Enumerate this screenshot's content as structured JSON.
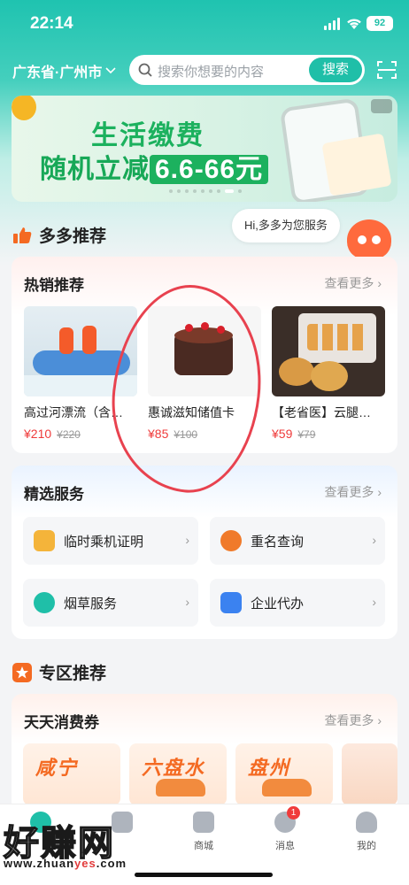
{
  "status": {
    "time": "22:14",
    "battery": "92"
  },
  "header": {
    "city": "广东省·广州市",
    "search_placeholder": "搜索你想要的内容",
    "search_button": "搜索"
  },
  "banner": {
    "line1": "生活缴费",
    "line2_prefix": "随机立减",
    "line2_amount": "6.6-66元"
  },
  "recommend": {
    "title": "多多推荐",
    "bubble": "Hi,多多为您服务"
  },
  "hot": {
    "title": "热销推荐",
    "more": "查看更多",
    "items": [
      {
        "name": "高过河漂流（含…",
        "price": "¥210",
        "old_price": "¥220"
      },
      {
        "name": "惠诚滋知储值卡",
        "price": "¥85",
        "old_price": "¥100"
      },
      {
        "name": "【老省医】云腿…",
        "price": "¥59",
        "old_price": "¥79"
      }
    ]
  },
  "services": {
    "title": "精选服务",
    "more": "查看更多",
    "items": [
      {
        "label": "临时乘机证明"
      },
      {
        "label": "重名查询"
      },
      {
        "label": "烟草服务"
      },
      {
        "label": "企业代办"
      }
    ]
  },
  "zone": {
    "title": "专区推荐"
  },
  "coupons": {
    "title": "天天消费券",
    "more": "查看更多",
    "items": [
      {
        "label": "咸宁"
      },
      {
        "label": "六盘水"
      },
      {
        "label": "盘州"
      }
    ]
  },
  "tabbar": {
    "items": [
      {
        "label": ""
      },
      {
        "label": ""
      },
      {
        "label": "商城"
      },
      {
        "label": "消息",
        "badge": "1"
      },
      {
        "label": "我的"
      }
    ]
  },
  "watermark": {
    "main": "好赚网",
    "url_prefix": "www.zhuan",
    "url_highlight": "yes",
    "url_suffix": ".com"
  }
}
